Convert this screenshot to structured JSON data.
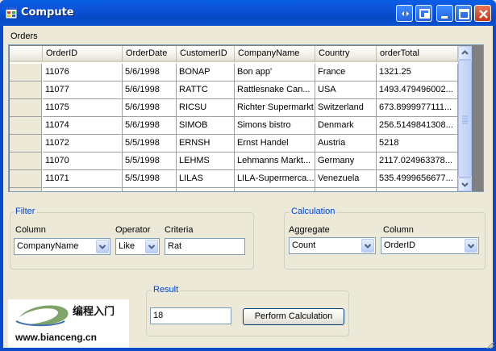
{
  "window": {
    "title": "Compute",
    "title_icon": "app-window-icon",
    "controls": [
      "help-icon",
      "restore-icon",
      "minimize-icon",
      "maximize-icon",
      "close-icon"
    ]
  },
  "orders": {
    "label": "Orders",
    "columns": [
      "OrderID",
      "OrderDate",
      "CustomerID",
      "CompanyName",
      "Country",
      "orderTotal"
    ],
    "rows": [
      [
        "11076",
        "5/6/1998",
        "BONAP",
        "Bon app'",
        "France",
        "1321.25"
      ],
      [
        "11077",
        "5/6/1998",
        "RATTC",
        "Rattlesnake Can...",
        "USA",
        "1493.479496002..."
      ],
      [
        "11075",
        "5/6/1998",
        "RICSU",
        "Richter Supermarkt",
        "Switzerland",
        "673.8999977111..."
      ],
      [
        "11074",
        "5/6/1998",
        "SIMOB",
        "Simons bistro",
        "Denmark",
        "256.5149841308..."
      ],
      [
        "11072",
        "5/5/1998",
        "ERNSH",
        "Ernst Handel",
        "Austria",
        "5218"
      ],
      [
        "11070",
        "5/5/1998",
        "LEHMS",
        "Lehmanns Markt...",
        "Germany",
        "2117.024963378..."
      ],
      [
        "11071",
        "5/5/1998",
        "LILAS",
        "LILA-Supermerca...",
        "Venezuela",
        "535.4999656677..."
      ]
    ]
  },
  "filter": {
    "title": "Filter",
    "column_label": "Column",
    "column_value": "CompanyName",
    "operator_label": "Operator",
    "operator_value": "Like",
    "criteria_label": "Criteria",
    "criteria_value": "Rat"
  },
  "calculation": {
    "title": "Calculation",
    "aggregate_label": "Aggregate",
    "aggregate_value": "Count",
    "column_label": "Column",
    "column_value": "OrderID"
  },
  "result": {
    "title": "Result",
    "value": "18",
    "button_label": "Perform Calculation"
  },
  "watermark": {
    "cn_text": "编程入门",
    "url": "www.bianceng.cn"
  },
  "colors": {
    "titlebar": "#0a5fe6",
    "group_label": "#0046d5",
    "face": "#ece9d8"
  }
}
